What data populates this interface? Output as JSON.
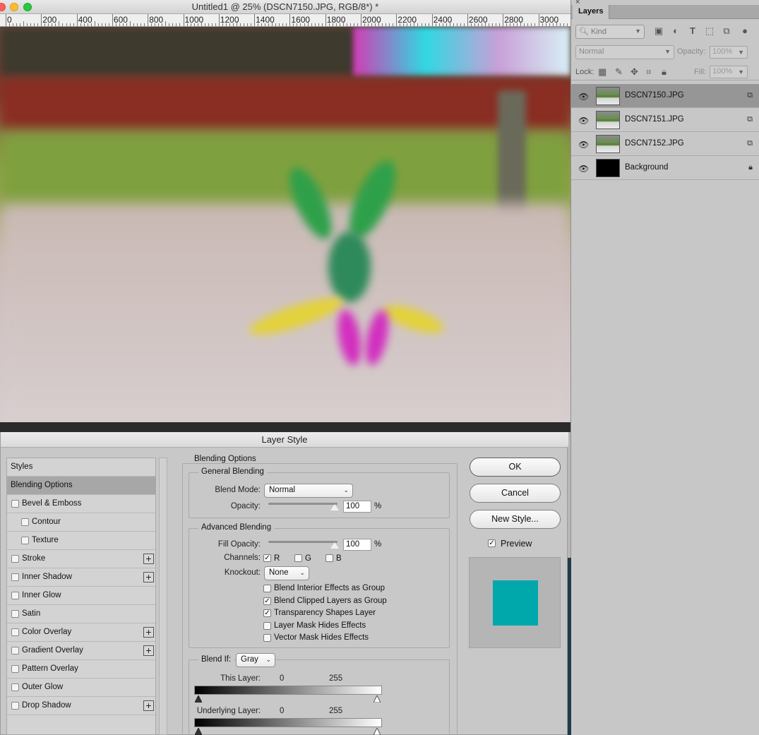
{
  "document": {
    "title": "Untitled1 @ 25% (DSCN7150.JPG, RGB/8*) *",
    "ruler_ticks": [
      "0",
      "200",
      "400",
      "600",
      "800",
      "1000",
      "1200",
      "1400",
      "1600",
      "1800",
      "2000",
      "2200",
      "2400",
      "2600",
      "2800",
      "3000"
    ]
  },
  "layers_panel": {
    "close": "×",
    "tab": "Layers",
    "kind_filter": "Kind",
    "blend_mode": "Normal",
    "opacity_label": "Opacity:",
    "opacity_value": "100%",
    "lock_label": "Lock:",
    "fill_label": "Fill:",
    "fill_value": "100%",
    "layers": [
      {
        "name": "DSCN7150.JPG",
        "selected": true
      },
      {
        "name": "DSCN7151.JPG",
        "selected": false
      },
      {
        "name": "DSCN7152.JPG",
        "selected": false
      },
      {
        "name": "Background",
        "selected": false
      }
    ]
  },
  "dialog": {
    "title": "Layer Style",
    "styles": [
      {
        "label": "Styles",
        "checkbox": false,
        "plus": false,
        "indent": 0,
        "active": false
      },
      {
        "label": "Blending Options",
        "checkbox": false,
        "plus": false,
        "indent": 0,
        "active": true
      },
      {
        "label": "Bevel & Emboss",
        "checkbox": true,
        "plus": false,
        "indent": 0,
        "active": false
      },
      {
        "label": "Contour",
        "checkbox": true,
        "plus": false,
        "indent": 1,
        "active": false
      },
      {
        "label": "Texture",
        "checkbox": true,
        "plus": false,
        "indent": 1,
        "active": false
      },
      {
        "label": "Stroke",
        "checkbox": true,
        "plus": true,
        "indent": 0,
        "active": false
      },
      {
        "label": "Inner Shadow",
        "checkbox": true,
        "plus": true,
        "indent": 0,
        "active": false
      },
      {
        "label": "Inner Glow",
        "checkbox": true,
        "plus": false,
        "indent": 0,
        "active": false
      },
      {
        "label": "Satin",
        "checkbox": true,
        "plus": false,
        "indent": 0,
        "active": false
      },
      {
        "label": "Color Overlay",
        "checkbox": true,
        "plus": true,
        "indent": 0,
        "active": false
      },
      {
        "label": "Gradient Overlay",
        "checkbox": true,
        "plus": true,
        "indent": 0,
        "active": false
      },
      {
        "label": "Pattern Overlay",
        "checkbox": true,
        "plus": false,
        "indent": 0,
        "active": false
      },
      {
        "label": "Outer Glow",
        "checkbox": true,
        "plus": false,
        "indent": 0,
        "active": false
      },
      {
        "label": "Drop Shadow",
        "checkbox": true,
        "plus": true,
        "indent": 0,
        "active": false
      }
    ],
    "blending_options_title": "Blending Options",
    "general_blending": {
      "title": "General Blending",
      "blend_mode_label": "Blend Mode:",
      "blend_mode_value": "Normal",
      "opacity_label": "Opacity:",
      "opacity_value": "100",
      "opacity_unit": "%"
    },
    "advanced_blending": {
      "title": "Advanced Blending",
      "fill_opacity_label": "Fill Opacity:",
      "fill_opacity_value": "100",
      "fill_opacity_unit": "%",
      "channels_label": "Channels:",
      "channel_r": "R",
      "channel_g": "G",
      "channel_b": "B",
      "knockout_label": "Knockout:",
      "knockout_value": "None",
      "options": [
        {
          "label": "Blend Interior Effects as Group",
          "checked": false
        },
        {
          "label": "Blend Clipped Layers as Group",
          "checked": true
        },
        {
          "label": "Transparency Shapes Layer",
          "checked": true
        },
        {
          "label": "Layer Mask Hides Effects",
          "checked": false
        },
        {
          "label": "Vector Mask Hides Effects",
          "checked": false
        }
      ]
    },
    "blend_if": {
      "label": "Blend If:",
      "value": "Gray",
      "this_layer_label": "This Layer:",
      "this_layer_low": "0",
      "this_layer_high": "255",
      "underlying_label": "Underlying Layer:",
      "underlying_low": "0",
      "underlying_high": "255"
    },
    "buttons": {
      "ok": "OK",
      "cancel": "Cancel",
      "new_style": "New Style...",
      "preview_label": "Preview"
    },
    "preview_color": "#00a7ab"
  }
}
